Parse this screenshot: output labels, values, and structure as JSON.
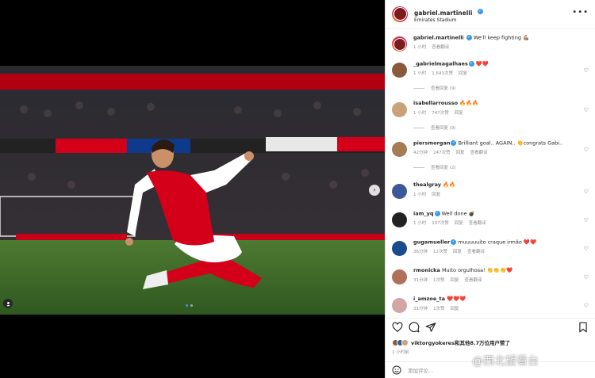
{
  "post": {
    "author": "gabriel.martinelli",
    "location": "Emirates Stadium",
    "caption": "We'll keep fighting 💪🏽",
    "caption_time": "1 小时",
    "caption_translate": "查看翻译"
  },
  "photo": {
    "slide_count": 2,
    "active_slide": 1
  },
  "comments": [
    {
      "user": "_gabrielmagalhaes",
      "verified": true,
      "text": "❤️❤️",
      "time": "1 小时",
      "likes": "1,643次赞",
      "reply": "回复",
      "translate": "",
      "view_replies": "查看回复 (9)",
      "avatar_color": "#8a5a3c"
    },
    {
      "user": "isabellarrousso",
      "verified": false,
      "text": "🔥🔥🔥",
      "time": "1 小时",
      "likes": "747次赞",
      "reply": "回复",
      "translate": "",
      "view_replies": "查看回复 (9)",
      "avatar_color": "#c9a27a"
    },
    {
      "user": "piersmorgan",
      "verified": true,
      "text": "Brilliant goal.. AGAIN.. 👏congrats Gabi..",
      "time": "42分钟",
      "likes": "247次赞",
      "reply": "回复",
      "translate": "查看翻译",
      "view_replies": "查看回复 (2)",
      "avatar_color": "#a67c52"
    },
    {
      "user": "thealgray",
      "verified": false,
      "text": "🔥🔥",
      "time": "1 小时",
      "likes": "",
      "reply": "回复",
      "translate": "",
      "view_replies": "",
      "avatar_color": "#3b5998"
    },
    {
      "user": "iam_yq",
      "verified": true,
      "text": "Well done 💣",
      "time": "1 小时",
      "likes": "107次赞",
      "reply": "回复",
      "translate": "查看翻译",
      "view_replies": "",
      "avatar_color": "#222"
    },
    {
      "user": "gugamueller",
      "verified": true,
      "text": "muuuuuito craque irmão ❤️❤️",
      "time": "36分钟",
      "likes": "12次赞",
      "reply": "回复",
      "translate": "查看翻译",
      "view_replies": "",
      "avatar_color": "#1a4b8c"
    },
    {
      "user": "rmonicka",
      "verified": false,
      "text": "Muito orgulhosa! 👏👏👏❤️",
      "time": "31分钟",
      "likes": "1次赞",
      "reply": "回复",
      "translate": "查看翻译",
      "view_replies": "",
      "avatar_color": "#b0705a"
    },
    {
      "user": "i_amzoe_ta",
      "verified": false,
      "text": "❤️❤️❤️",
      "time": "31分钟",
      "likes": "1次赞",
      "reply": "回复",
      "translate": "",
      "view_replies": "",
      "avatar_color": "#d4a5a5"
    }
  ],
  "likes_line": "viktorgyokeres和其他8.7万位用户赞了",
  "post_time": "1 小时前",
  "add_comment_placeholder": "添加评论...",
  "watermark": "@西北望看台",
  "colors": {
    "verified": "#3897f0",
    "arsenal_red": "#db0007",
    "pitch": "#3f6b2a"
  },
  "icons": {
    "like": "heart-outline-icon",
    "comment": "comment-icon",
    "share": "paper-plane-icon",
    "save": "bookmark-icon",
    "more": "more-horizontal-icon",
    "emoji": "emoji-icon"
  }
}
